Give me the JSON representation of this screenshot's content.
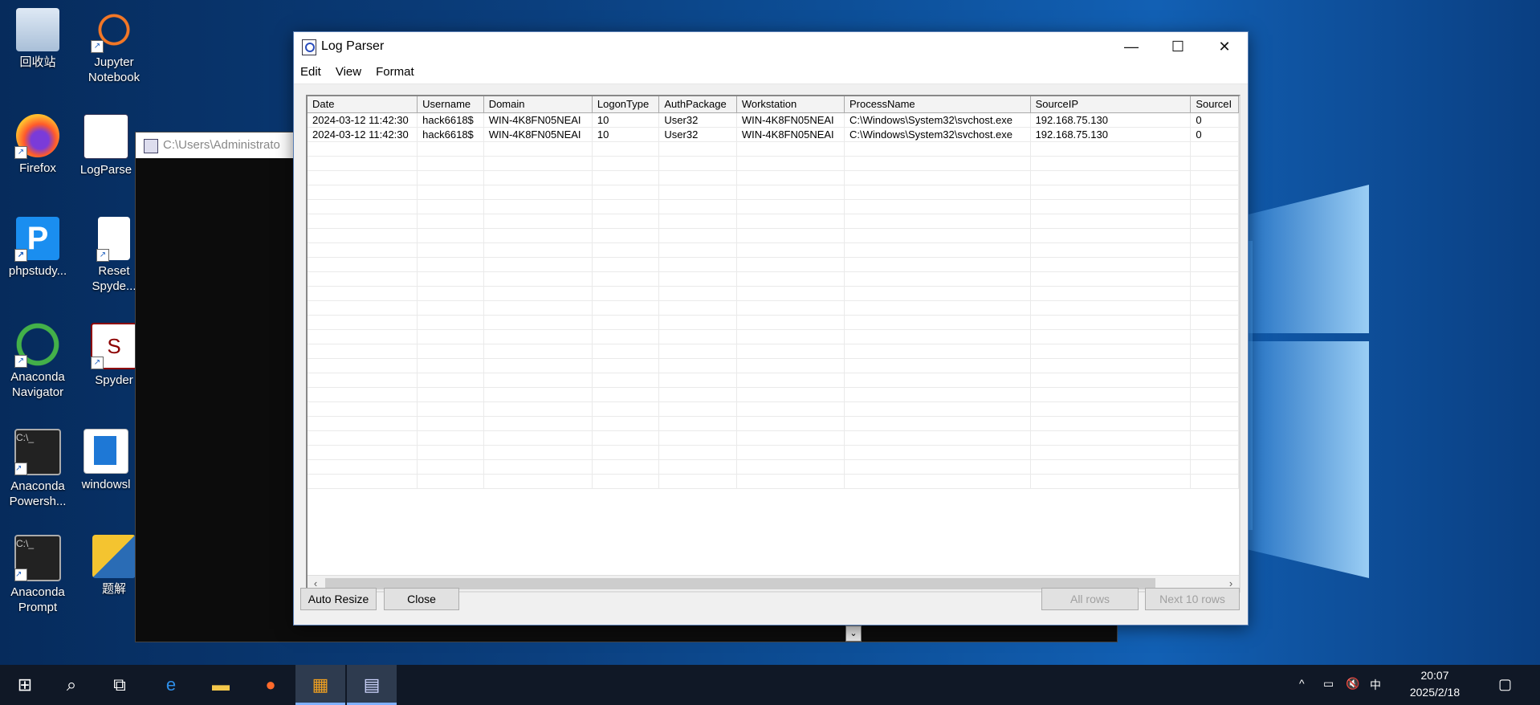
{
  "desktop": {
    "icons": [
      {
        "label": "回收站"
      },
      {
        "label": "Jupyter Notebook"
      },
      {
        "label": "Firefox"
      },
      {
        "label": "LogParse"
      },
      {
        "label": "phpstudy..."
      },
      {
        "label": "Reset Spyde..."
      },
      {
        "label": "Anaconda Navigator"
      },
      {
        "label": "Spyder"
      },
      {
        "label": "Anaconda Powersh..."
      },
      {
        "label": "windowsl"
      },
      {
        "label": "Anaconda Prompt"
      },
      {
        "label": "题解"
      }
    ]
  },
  "console_window": {
    "title": "C:\\Users\\Administrato"
  },
  "window": {
    "title": "Log Parser",
    "minimize": "—",
    "maximize": "☐",
    "close": "✕"
  },
  "menu": {
    "edit": "Edit",
    "view": "View",
    "format": "Format"
  },
  "grid": {
    "columns": [
      "Date",
      "Username",
      "Domain",
      "LogonType",
      "AuthPackage",
      "Workstation",
      "ProcessName",
      "SourceIP",
      "SourceI"
    ],
    "rows": [
      [
        "2024-03-12 11:42:30",
        "hack6618$",
        "WIN-4K8FN05NEAI",
        "10",
        "User32",
        "WIN-4K8FN05NEAI",
        "C:\\Windows\\System32\\svchost.exe",
        "192.168.75.130",
        "0"
      ],
      [
        "2024-03-12 11:42:30",
        "hack6618$",
        "WIN-4K8FN05NEAI",
        "10",
        "User32",
        "WIN-4K8FN05NEAI",
        "C:\\Windows\\System32\\svchost.exe",
        "192.168.75.130",
        "0"
      ]
    ]
  },
  "buttons": {
    "auto_resize": "Auto Resize",
    "close": "Close",
    "all_rows": "All rows",
    "next_rows": "Next 10 rows"
  },
  "taskbar": {
    "start_icon": "windows-start-icon",
    "search_icon": "search-icon",
    "taskview_icon": "task-view-icon"
  },
  "tray": {
    "ime": "中",
    "time": "20:07",
    "date": "2025/2/18"
  }
}
